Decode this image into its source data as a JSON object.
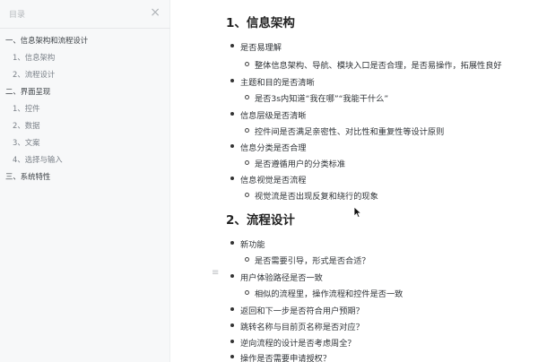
{
  "sidebar": {
    "title": "目录",
    "close_glyph": "×",
    "items": [
      {
        "label": "一、信息架构和流程设计",
        "level": 1
      },
      {
        "label": "1、信息架构",
        "level": 2
      },
      {
        "label": "2、流程设计",
        "level": 2
      },
      {
        "label": "二、界面呈现",
        "level": 1
      },
      {
        "label": "1、控件",
        "level": 2
      },
      {
        "label": "2、数据",
        "level": 2
      },
      {
        "label": "3、文案",
        "level": 2
      },
      {
        "label": "4、选择与输入",
        "level": 2
      },
      {
        "label": "三、系统特性",
        "level": 1
      }
    ]
  },
  "content": {
    "section1": {
      "heading": "1、信息架构",
      "items": [
        {
          "text": "是否易理解",
          "level": 1
        },
        {
          "text": "整体信息架构、导航、模块入口是否合理，是否易操作，拓展性良好",
          "level": 2
        },
        {
          "text": "主题和目的是否清晰",
          "level": 1
        },
        {
          "text": "是否3s内知道“我在哪”“我能干什么”",
          "level": 2
        },
        {
          "text": "信息层级是否清晰",
          "level": 1
        },
        {
          "text": "控件间是否满足亲密性、对比性和重复性等设计原则",
          "level": 2
        },
        {
          "text": "信息分类是否合理",
          "level": 1
        },
        {
          "text": "是否遵循用户的分类标准",
          "level": 2
        },
        {
          "text": "信息视觉是否流程",
          "level": 1
        },
        {
          "text": "视觉流是否出现反复和绕行的现象",
          "level": 2
        }
      ]
    },
    "section2": {
      "heading": "2、流程设计",
      "items": [
        {
          "text": "新功能",
          "level": 1
        },
        {
          "text": "是否需要引导，形式是否合适？",
          "level": 2
        },
        {
          "text": "用户体验路径是否一致",
          "level": 1
        },
        {
          "text": "相似的流程里，操作流程和控件是否一致",
          "level": 2
        },
        {
          "text": "返回和下一步是否符合用户预期？",
          "level": 1
        },
        {
          "text": "跳转名称与目前页名称是否对应？",
          "level": 1
        },
        {
          "text": "逆向流程的设计是否考虑周全？",
          "level": 1
        },
        {
          "text": "操作是否需要申请授权？",
          "level": 1
        }
      ]
    },
    "drag_handle_glyph": "≡"
  }
}
